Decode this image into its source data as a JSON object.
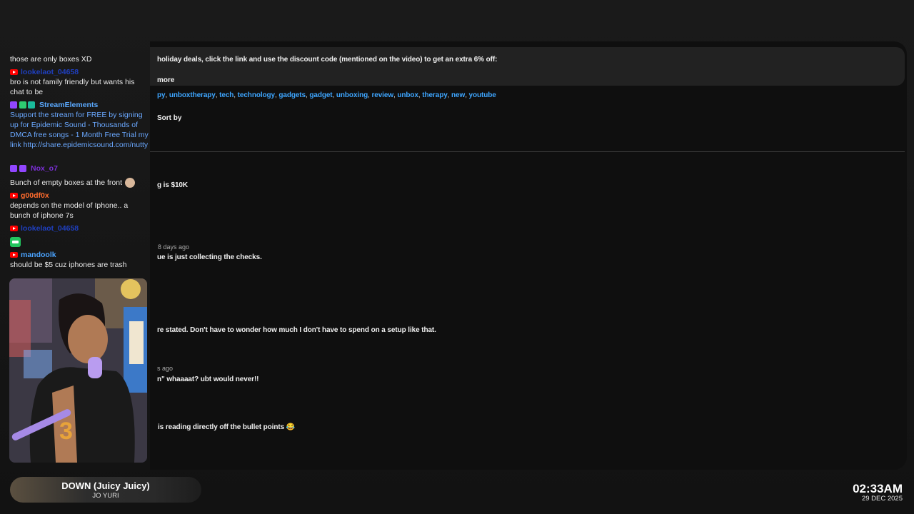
{
  "youtube": {
    "description_line": "holiday deals, click the link and use the discount code (mentioned on the video) to get an extra 6% off:",
    "more_label": "more",
    "tags": [
      "py",
      "unboxtherapy",
      "tech",
      "technology",
      "gadgets",
      "gadget",
      "unboxing",
      "review",
      "unbox",
      "therapy",
      "new",
      "youtube"
    ],
    "sort_by_label": "Sort by",
    "comments": [
      {
        "time": "",
        "text": "g is $10K"
      },
      {
        "time": "8 days ago",
        "text": "ue is just collecting the checks."
      },
      {
        "time": "",
        "text": "re stated. Don't have to wonder how much I don't have to spend on a setup like that."
      },
      {
        "time": "s ago",
        "text": "n\" whaaaat? ubt would never!!"
      },
      {
        "time": "",
        "text": "is reading directly off the bullet points 😂"
      }
    ]
  },
  "chat": {
    "messages": [
      {
        "platform": "",
        "user": "",
        "text": "those are only boxes XD",
        "user_color": ""
      },
      {
        "platform": "youtube",
        "user": "lookelaot_04658",
        "text": "bro is not family friendly but wants his chat to be",
        "user_color": "#1f3fbf"
      },
      {
        "platform": "twitch",
        "user": "StreamElements",
        "text": "Support the stream for FREE by signing up for Epidemic Sound - Thousands of DMCA free songs - 1 Month Free Trial my link http://share.epidemicsound.com/nutty",
        "user_color": "#5aa9ff"
      },
      {
        "platform": "twitch",
        "user": "Nox_o7",
        "text": "Bunch of empty boxes at the front",
        "user_color": "#7b2fd6"
      },
      {
        "platform": "youtube",
        "user": "g00df0x",
        "text": "depends on the model of Iphone.. a bunch of iphone 7s",
        "user_color": "#ff6b2d"
      },
      {
        "platform": "youtube",
        "user": "lookelaot_04658",
        "text": "",
        "user_color": "#1f3fbf"
      },
      {
        "platform": "youtube",
        "user": "mandoolk",
        "text": "should be $5 cuz iphones are trash",
        "user_color": "#4aa3ff"
      }
    ]
  },
  "now_playing": {
    "title": "DOWN (Juicy Juicy)",
    "artist": "JO YURI"
  },
  "clock": {
    "time": "02:33AM",
    "date": "29 DEC 2025"
  }
}
